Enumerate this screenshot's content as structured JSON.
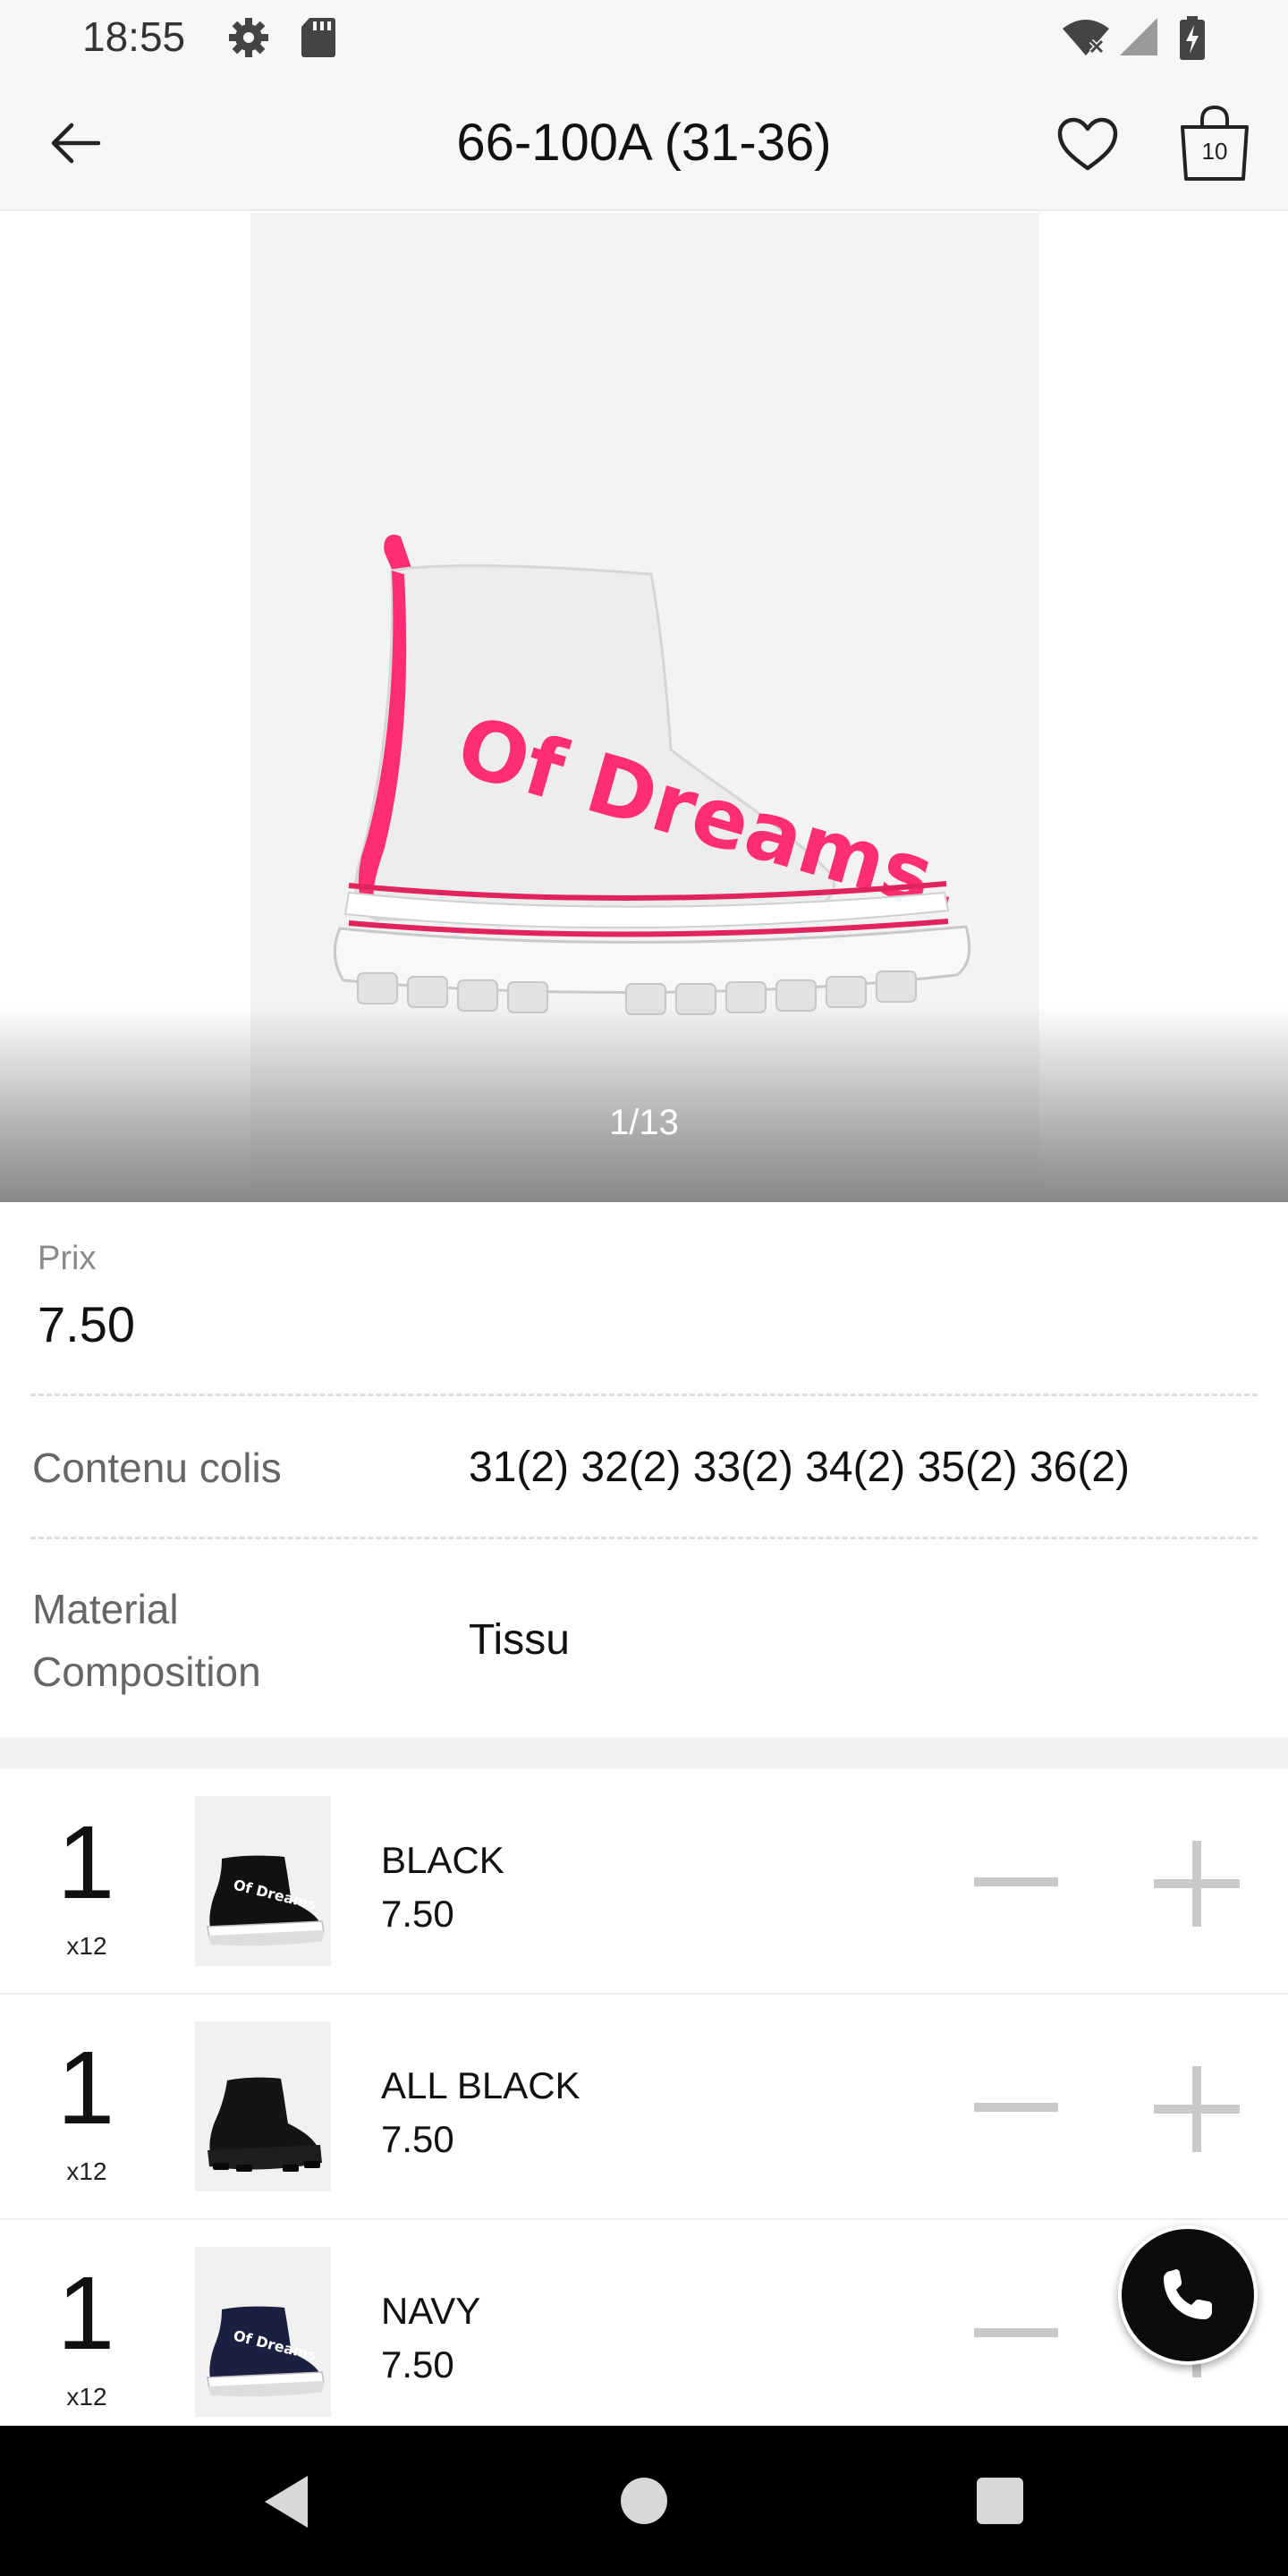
{
  "status_bar": {
    "time": "18:55",
    "left_icons": [
      "settings-icon",
      "sd-card-icon"
    ],
    "right_icons": [
      "wifi-off-icon",
      "cell-signal-icon",
      "battery-charging-icon"
    ]
  },
  "app_bar": {
    "title": "66-100A (31-36)",
    "back_icon": "arrow-left-icon",
    "favorite_icon": "heart-icon",
    "cart_icon": "shopping-bag-icon",
    "cart_count": "10"
  },
  "gallery": {
    "image_text": "Of Dreams.",
    "counter": "1/13"
  },
  "product": {
    "price_label": "Prix",
    "price_value": "7.50",
    "pack_label": "Contenu colis",
    "pack_value": "31(2) 32(2) 33(2) 34(2) 35(2) 36(2)",
    "material_label_line1": "Material",
    "material_label_line2": "Composition",
    "material_value": "Tissu"
  },
  "variants": [
    {
      "qty": "1",
      "multiplier": "x12",
      "name": "BLACK",
      "price": "7.50",
      "thumb_text": "Of Dreams"
    },
    {
      "qty": "1",
      "multiplier": "x12",
      "name": "ALL BLACK",
      "price": "7.50",
      "thumb_text": ""
    },
    {
      "qty": "1",
      "multiplier": "x12",
      "name": "NAVY",
      "price": "7.50",
      "thumb_text": "Of Dreams"
    }
  ],
  "fab": {
    "icon": "phone-icon"
  },
  "nav_bar": {
    "icons": [
      "nav-back-icon",
      "nav-home-icon",
      "nav-recents-icon"
    ]
  },
  "colors": {
    "accent_pink": "#ff2e73",
    "divider": "#dedede",
    "stepper_grey": "#c9c9c9"
  }
}
